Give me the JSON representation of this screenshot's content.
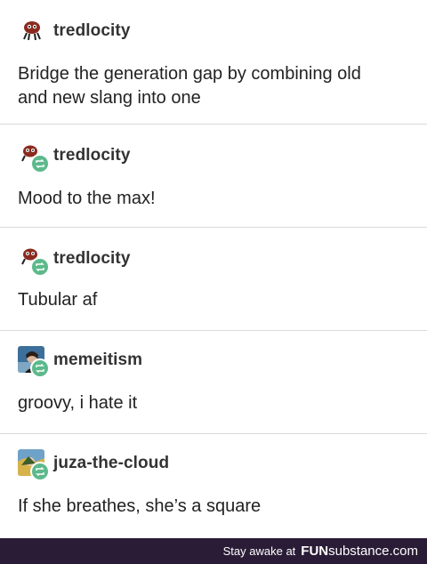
{
  "posts": [
    {
      "username": "tredlocity",
      "text": "Bridge the generation gap by combining old\nand new slang into one",
      "avatar": "creature-icon",
      "reblog": false
    },
    {
      "username": "tredlocity",
      "text": "Mood to the max!",
      "avatar": "creature-icon",
      "reblog": true
    },
    {
      "username": "tredlocity",
      "text": "Tubular af",
      "avatar": "creature-icon",
      "reblog": true
    },
    {
      "username": "memeitism",
      "text": "groovy, i hate it",
      "avatar": "person-photo",
      "reblog": true
    },
    {
      "username": "juza-the-cloud",
      "text": "If she breathes, she’s a square",
      "avatar": "character-art",
      "reblog": true
    }
  ],
  "footer": {
    "prefix": "Stay awake at",
    "brand_bold": "FUN",
    "brand_light": "substance.com"
  },
  "colors": {
    "reblog_badge": "#5db98b",
    "footer_bg": "#2a1c36",
    "creature": "#8b2a1e"
  }
}
